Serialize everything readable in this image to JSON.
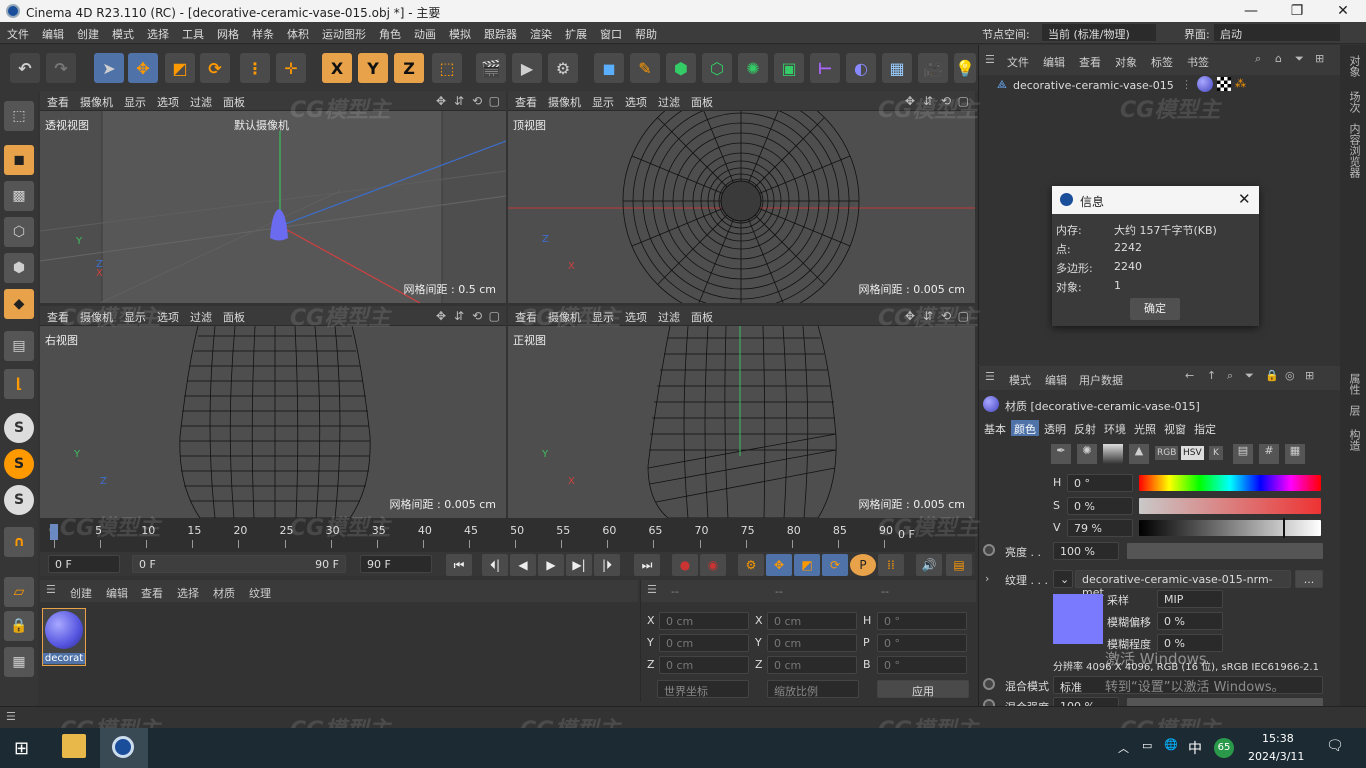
{
  "titlebar": {
    "app": "Cinema 4D R23.110 (RC) - [decorative-ceramic-vase-015.obj *] - 主要"
  },
  "menu": [
    "文件",
    "编辑",
    "创建",
    "模式",
    "选择",
    "工具",
    "网格",
    "样条",
    "体积",
    "运动图形",
    "角色",
    "动画",
    "模拟",
    "跟踪器",
    "渲染",
    "扩展",
    "窗口",
    "帮助"
  ],
  "node_space": {
    "label": "节点空间:",
    "value": "当前 (标准/物理)"
  },
  "layout": {
    "label": "界面:",
    "value": "启动"
  },
  "toolbar": {
    "x": "X",
    "y": "Y",
    "z": "Z"
  },
  "viewport_menu": [
    "查看",
    "摄像机",
    "显示",
    "选项",
    "过滤",
    "面板"
  ],
  "viewports": {
    "persp": {
      "name": "透视视图",
      "camera": "默认摄像机",
      "grid": "网格间距 : 0.5 cm"
    },
    "top": {
      "name": "顶视图",
      "grid": "网格间距 : 0.005 cm"
    },
    "right": {
      "name": "右视图",
      "grid": "网格间距 : 0.005 cm"
    },
    "front": {
      "name": "正视图",
      "grid": "网格间距 : 0.005 cm"
    }
  },
  "axes": {
    "x": "X",
    "y": "Y",
    "z": "Z"
  },
  "timeline": {
    "ticks": [
      "0",
      "5",
      "10",
      "15",
      "20",
      "25",
      "30",
      "35",
      "40",
      "45",
      "50",
      "55",
      "60",
      "65",
      "70",
      "75",
      "80",
      "85",
      "90"
    ],
    "current": "0 F"
  },
  "transport": {
    "start": "0 F",
    "range_start": "0 F",
    "range_end": "90 F",
    "end": "90 F"
  },
  "material_manager": {
    "menu": [
      "创建",
      "编辑",
      "查看",
      "选择",
      "材质",
      "纹理"
    ],
    "material": "decorat"
  },
  "coords": {
    "header": [
      "--",
      "--",
      "--"
    ],
    "rows": [
      {
        "a": "X",
        "av": "0 cm",
        "b": "X",
        "bv": "0 cm",
        "c": "H",
        "cv": "0 °"
      },
      {
        "a": "Y",
        "av": "0 cm",
        "b": "Y",
        "bv": "0 cm",
        "c": "P",
        "cv": "0 °"
      },
      {
        "a": "Z",
        "av": "0 cm",
        "b": "Z",
        "bv": "0 cm",
        "c": "B",
        "cv": "0 °"
      }
    ],
    "world": "世界坐标",
    "scale": "缩放比例",
    "apply": "应用"
  },
  "objects": {
    "menu": [
      "文件",
      "编辑",
      "查看",
      "对象",
      "标签",
      "书签"
    ],
    "item": "decorative-ceramic-vase-015"
  },
  "info_dialog": {
    "title": "信息",
    "rows": [
      {
        "k": "内存:",
        "v": "大约 157千字节(KB)"
      },
      {
        "k": "点:",
        "v": "2242"
      },
      {
        "k": "多边形:",
        "v": "2240"
      },
      {
        "k": "对象:",
        "v": "1"
      }
    ],
    "ok": "确定"
  },
  "attributes": {
    "menu": [
      "模式",
      "编辑",
      "用户数据"
    ],
    "material": "材质 [decorative-ceramic-vase-015]",
    "tabs": [
      "基本",
      "颜色",
      "透明",
      "反射",
      "环境",
      "光照",
      "视窗",
      "指定"
    ],
    "active_tab": "颜色",
    "color_modes": [
      "RGB",
      "HSV",
      "K"
    ],
    "h": {
      "label": "H",
      "value": "0 °"
    },
    "s": {
      "label": "S",
      "value": "0 %"
    },
    "v": {
      "label": "V",
      "value": "79 %"
    },
    "brightness": {
      "label": "亮度 . .",
      "value": "100 %"
    },
    "texture": {
      "label": "纹理 . . .",
      "value": "decorative-ceramic-vase-015-nrm-met",
      "more": "..."
    },
    "sampling": {
      "label": "采样",
      "value": "MIP"
    },
    "blur_offset": {
      "label": "模糊偏移",
      "value": "0 %"
    },
    "blur_scale": {
      "label": "模糊程度",
      "value": "0 %"
    },
    "resolution": "分辨率 4096 X 4096, RGB (16 位), sRGB IEC61966-2.1",
    "mix_mode": {
      "label": "混合模式",
      "value": "标准"
    },
    "mix_strength": {
      "label": "混合强度",
      "value": "100 %"
    },
    "activate": "激活 Windows",
    "activate2": "转到“设置”以激活 Windows。"
  },
  "right_tabs": [
    "对象",
    "场次",
    "内容浏览器",
    "属性",
    "层",
    "构造"
  ],
  "taskbar": {
    "time": "15:38",
    "date": "2024/3/11",
    "lang": "中",
    "badge": "65"
  },
  "colors": {
    "accent": "#4f73a8",
    "vase": "#6b6bf0"
  }
}
